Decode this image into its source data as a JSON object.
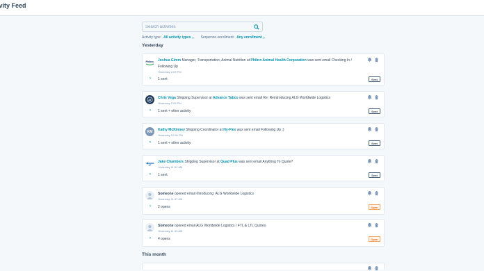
{
  "header": {
    "title": "ivity Feed"
  },
  "search": {
    "placeholder": "Search activities"
  },
  "filters": {
    "activity_type_label": "Activity type:",
    "activity_type_value": "All activity types",
    "sequence_label": "Sequence enrollment:",
    "sequence_value": "Any enrollment"
  },
  "sections": {
    "yesterday": "Yesterday",
    "this_month": "This month"
  },
  "cards": [
    {
      "avatar": "phibro-logo",
      "avatar_initials": "Phibro",
      "name": "Joshua Gimm",
      "role": "Manager, Transportation, Animal Nutrition at",
      "company": "Phibro Animal Health Corporation",
      "action": "was sent email",
      "subject": "Checking In / Following Up",
      "time": "Yesterday 2:22 PM",
      "summary": "1 sent",
      "status": "Sent"
    },
    {
      "avatar": "advance-tabco-logo",
      "avatar_initials": "AT",
      "name": "Chris Vega",
      "role": "Shipping Supervisor at",
      "company": "Advance Tabco",
      "action": "was sent email",
      "subject": "Re: Reintroducing ALG Worldwide Logistics",
      "time": "Yesterday 2:05 PM",
      "summary": "1 sent + other activity",
      "status": "Sent"
    },
    {
      "avatar": "initials",
      "avatar_initials": "KM",
      "name": "Kathy McKinney",
      "role": "Shipping Coordinator at",
      "company": "Hy-Flex",
      "action": "was sent email",
      "subject": "Following Up :)",
      "time": "Yesterday 12:56 PM",
      "summary": "1 sent + other activity",
      "status": "Sent"
    },
    {
      "avatar": "quad-plus-logo",
      "avatar_initials": "QP",
      "name": "Jake Chambers",
      "role": "Shipping Supervisor at",
      "company": "Quad Plus",
      "action": "was sent email",
      "subject": "Anything To Quote?",
      "time": "Yesterday 11:52 AM",
      "summary": "1 sent",
      "status": "Sent"
    },
    {
      "avatar": "unknown-person",
      "avatar_initials": "",
      "name": "Someone",
      "role": "",
      "company": "",
      "action": "opened email",
      "subject": "Introducing: ALG Worldwide Logistics",
      "time": "Yesterday 11:47 AM",
      "summary": "2 opens",
      "status": "Open"
    },
    {
      "avatar": "unknown-person",
      "avatar_initials": "",
      "name": "Someone",
      "role": "",
      "company": "",
      "action": "opened email",
      "subject": "ALG Worldwide Logistics / FTL & LTL Quotes",
      "time": "Yesterday 11:43 AM",
      "summary": "4 opens",
      "status": "Open"
    }
  ],
  "colors": {
    "accent": "#0091ae",
    "text": "#33475b",
    "open": "#e26a13",
    "background": "#f5f8fa"
  }
}
